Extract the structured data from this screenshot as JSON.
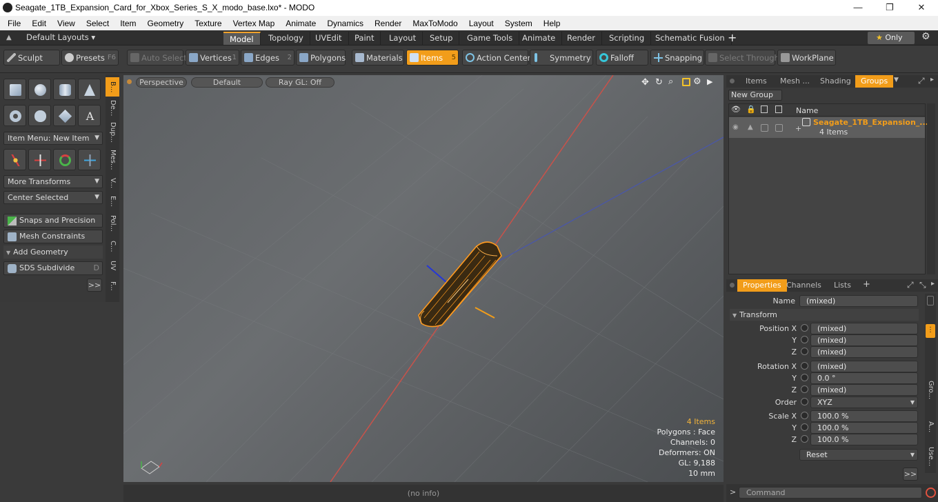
{
  "window": {
    "title": "Seagate_1TB_Expansion_Card_for_Xbox_Series_S_X_modo_base.lxo* - MODO",
    "minimize": "—",
    "maximize": "❐",
    "close": "✕"
  },
  "menu": [
    "File",
    "Edit",
    "View",
    "Select",
    "Item",
    "Geometry",
    "Texture",
    "Vertex Map",
    "Animate",
    "Dynamics",
    "Render",
    "MaxToModo",
    "Layout",
    "System",
    "Help"
  ],
  "layouts": {
    "dropdown": "Default Layouts",
    "tabs": [
      "Model",
      "Topology",
      "UVEdit",
      "Paint",
      "Layout",
      "Setup",
      "Game Tools",
      "Animate",
      "Render",
      "Scripting",
      "Schematic Fusion"
    ],
    "active": "Model",
    "add": "+",
    "only": "Only"
  },
  "toolbar": {
    "sculpt": "Sculpt",
    "presets": "Presets",
    "presets_key": "F6",
    "auto_select": "Auto Select",
    "vertices": "Vertices",
    "vertices_key": "1",
    "edges": "Edges",
    "edges_key": "2",
    "polygons": "Polygons",
    "materials": "Materials",
    "items": "Items",
    "items_key": "5",
    "action_center": "Action Center",
    "symmetry": "Symmetry",
    "falloff": "Falloff",
    "snapping": "Snapping",
    "select_through": "Select Through",
    "workplane": "WorkPlane"
  },
  "leftpanel": {
    "item_menu": "Item Menu: New Item",
    "more_transforms": "More Transforms",
    "center_selected": "Center Selected",
    "snaps": "Snaps and Precision",
    "mesh_constraints": "Mesh Constraints",
    "add_geometry": "Add Geometry",
    "sds_subdivide": "SDS Subdivide",
    "sds_key": "D",
    "more": ">>",
    "vtabs": [
      "B...",
      "De...",
      "Dup...",
      "Mes...",
      "V...",
      "E...",
      "Pol...",
      "C...",
      "UV",
      "F..."
    ]
  },
  "viewport": {
    "view": "Perspective",
    "shading": "Default",
    "raygl": "Ray GL: Off",
    "stats": {
      "items": "4 Items",
      "polygons": "Polygons : Face",
      "channels": "Channels: 0",
      "deformers": "Deformers: ON",
      "gl": "GL: 9,188",
      "unit": "10 mm"
    }
  },
  "groups_panel": {
    "tabs": [
      "Items",
      "Mesh ...",
      "Shading",
      "Groups"
    ],
    "active": "Groups",
    "new_group": "New Group",
    "col_name": "Name",
    "row_name": "Seagate_1TB_Expansion_...",
    "row_count": "4 Items"
  },
  "properties": {
    "tabs": [
      "Properties",
      "Channels",
      "Lists"
    ],
    "active": "Properties",
    "add": "+",
    "name_label": "Name",
    "name_value": "(mixed)",
    "transform": "Transform",
    "position_label": "Position X",
    "rotation_label": "Rotation X",
    "scale_label": "Scale X",
    "y": "Y",
    "z": "Z",
    "position": [
      "(mixed)",
      "(mixed)",
      "(mixed)"
    ],
    "rotation": [
      "(mixed)",
      "0.0 °",
      "(mixed)"
    ],
    "order_label": "Order",
    "order": "XYZ",
    "scale": [
      "100.0 %",
      "100.0 %",
      "100.0 %"
    ],
    "reset": "Reset",
    "more": ">>",
    "side_tabs": [
      "Gro...",
      "A...",
      "Use..."
    ]
  },
  "status": {
    "info": "(no info)",
    "command_prompt": ">",
    "command": "Command"
  },
  "colors": {
    "accent": "#f29d1a",
    "selection": "#ff9a1f"
  }
}
